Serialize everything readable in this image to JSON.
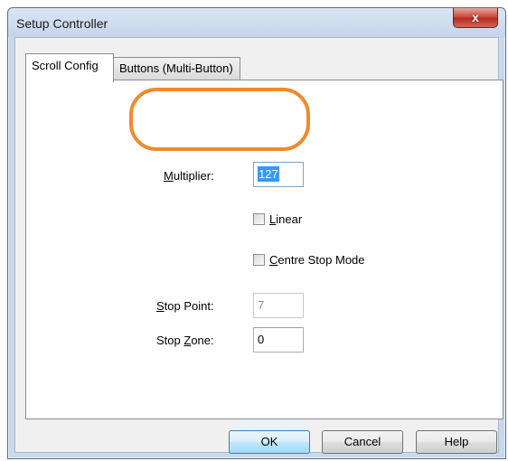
{
  "window": {
    "title": "Setup Controller",
    "close_glyph": "x"
  },
  "tabs": [
    {
      "label": "Scroll Config",
      "active": true
    },
    {
      "label": "Buttons (Multi-Button)",
      "active": false
    }
  ],
  "form": {
    "multiplier": {
      "label_access": "M",
      "label_rest": "ultiplier:",
      "value": "127"
    },
    "linear": {
      "label_access": "L",
      "label_rest": "inear",
      "checked": false
    },
    "centre_stop": {
      "label_access": "C",
      "label_rest": "entre Stop Mode",
      "checked": false
    },
    "stop_point": {
      "label_access": "S",
      "label_rest": "top Point:",
      "value": "7"
    },
    "stop_zone": {
      "label_before": "Stop ",
      "label_access": "Z",
      "label_rest": "one:",
      "value": "0"
    }
  },
  "buttons": {
    "ok": "OK",
    "cancel": "Cancel",
    "help": "Help"
  },
  "colors": {
    "annotation_highlight": "#f08a2c",
    "selection": "#3399ff"
  }
}
